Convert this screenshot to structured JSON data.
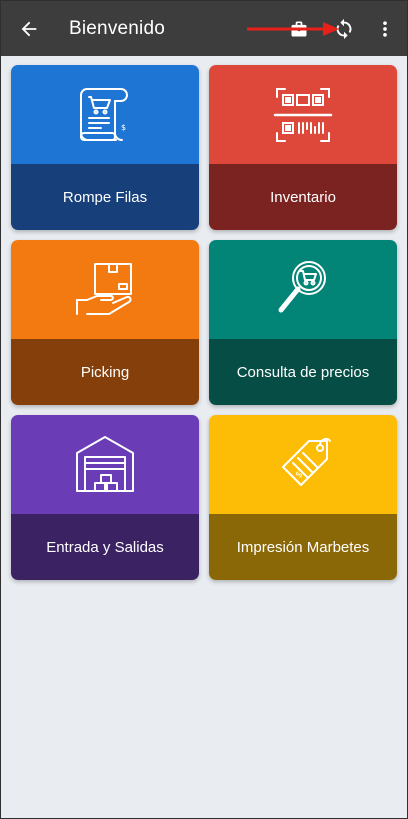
{
  "appbar": {
    "title": "Bienvenido",
    "icons": [
      "arrow-left-icon",
      "briefcase-icon",
      "sync-icon",
      "more-vert-icon"
    ]
  },
  "tiles": [
    {
      "label": "Rompe Filas",
      "icon": "receipt-cart-icon",
      "top_color": "#1f75d3",
      "bottom_color": "#173f79"
    },
    {
      "label": "Inventario",
      "icon": "barcode-scan-icon",
      "top_color": "#de483a",
      "bottom_color": "#7b2320"
    },
    {
      "label": "Picking",
      "icon": "box-hand-icon",
      "top_color": "#f27a10",
      "bottom_color": "#853f0b"
    },
    {
      "label": "Consulta de precios",
      "icon": "magnifier-cart-icon",
      "top_color": "#028577",
      "bottom_color": "#064d45"
    },
    {
      "label": "Entrada y Salidas",
      "icon": "warehouse-icon",
      "top_color": "#6a3cb6",
      "bottom_color": "#3b2263"
    },
    {
      "label": "Impresión Marbetes",
      "icon": "price-tag-icon",
      "top_color": "#fdbc05",
      "bottom_color": "#8a6707"
    }
  ]
}
